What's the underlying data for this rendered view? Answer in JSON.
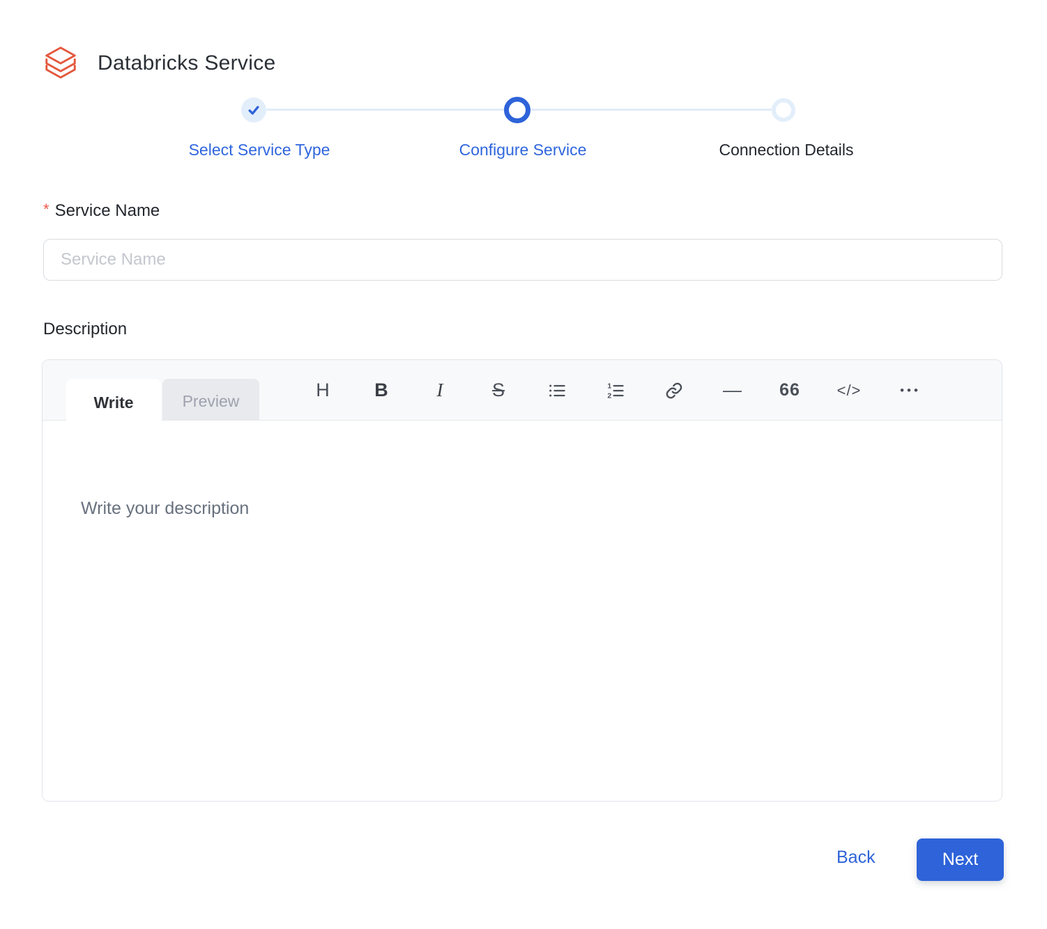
{
  "header": {
    "title": "Databricks Service",
    "logo_icon": "databricks-logo"
  },
  "stepper": {
    "steps": [
      {
        "label": "Select Service Type",
        "state": "completed"
      },
      {
        "label": "Configure Service",
        "state": "active"
      },
      {
        "label": "Connection Details",
        "state": "upcoming"
      }
    ]
  },
  "form": {
    "service_name": {
      "label": "Service Name",
      "required_marker": "*",
      "value": "",
      "placeholder": "Service Name"
    },
    "description": {
      "label": "Description",
      "editor": {
        "tabs": [
          {
            "label": "Write",
            "active": true
          },
          {
            "label": "Preview",
            "active": false
          }
        ],
        "toolbar": [
          {
            "name": "heading",
            "glyph": "H"
          },
          {
            "name": "bold",
            "glyph": "B"
          },
          {
            "name": "italic",
            "glyph": "I"
          },
          {
            "name": "strikethrough",
            "glyph": "S"
          },
          {
            "name": "bulleted-list",
            "glyph": ""
          },
          {
            "name": "numbered-list",
            "glyph": ""
          },
          {
            "name": "link",
            "glyph": ""
          },
          {
            "name": "horizontal-rule",
            "glyph": "—"
          },
          {
            "name": "quote",
            "glyph": "66"
          },
          {
            "name": "code",
            "glyph": "</>"
          },
          {
            "name": "more-options",
            "glyph": "•••"
          }
        ],
        "placeholder": "Write your description",
        "value": ""
      }
    }
  },
  "footer": {
    "back_label": "Back",
    "next_label": "Next"
  },
  "colors": {
    "accent_blue": "#2e63d9",
    "light_blue": "#e3eefb",
    "logo_red": "#e4583c",
    "asterisk_red": "#ee5a4e"
  }
}
